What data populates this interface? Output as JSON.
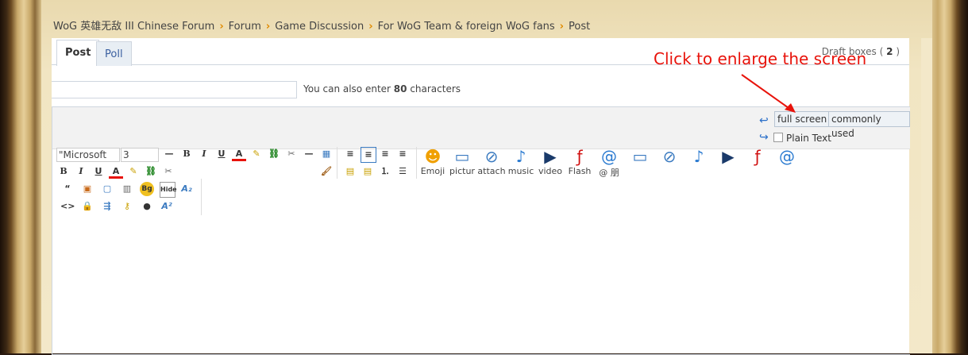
{
  "breadcrumb": [
    "WoG 英雄无敌 III Chinese Forum",
    "Forum",
    "Game Discussion",
    "For WoG Team & foreign WoG fans",
    "Post"
  ],
  "tabs": {
    "post": "Post",
    "poll": "Poll"
  },
  "draft": {
    "label": "Draft boxes (",
    "count": "2",
    "close": ")"
  },
  "subject": {
    "value": "",
    "info_pre": "You can also enter ",
    "info_count": "80",
    "info_post": " characters"
  },
  "editor": {
    "full_screen": "full screen",
    "commonly_used": "commonly used",
    "plain_text": "Plain Text",
    "font_name": "\"Microsoft",
    "font_size": "3",
    "media": [
      {
        "label": "Emoji",
        "icon": "emoji-icon"
      },
      {
        "label": "pictur",
        "icon": "picture-icon"
      },
      {
        "label": "attach",
        "icon": "attach-icon"
      },
      {
        "label": "music",
        "icon": "music-icon"
      },
      {
        "label": "video",
        "icon": "video-icon"
      },
      {
        "label": "Flash",
        "icon": "flash-icon"
      },
      {
        "label": "@ 朋",
        "icon": "at-icon"
      }
    ]
  },
  "annotation": "Click to enlarge the screen",
  "colors": {
    "accent": "#e08a00",
    "annotation": "#e8130b",
    "link": "#3a5fa0"
  }
}
